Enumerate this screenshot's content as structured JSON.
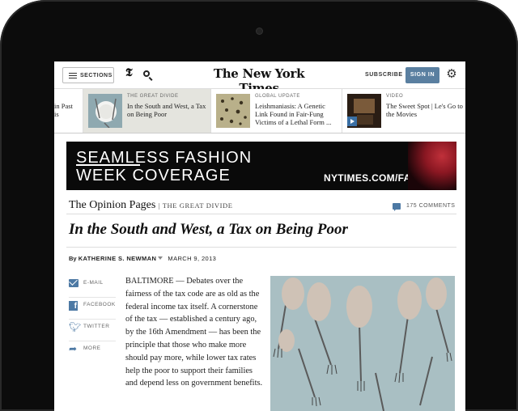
{
  "header": {
    "sections_label": "SECTIONS",
    "t_logo": "𝕿",
    "masthead": "The New York Times",
    "subscribe_label": "SUBSCRIBE",
    "signin_label": "SIGN IN"
  },
  "strip": {
    "items": [
      {
        "kicker": "",
        "headline": "in Past is"
      },
      {
        "kicker": "THE GREAT DIVIDE",
        "headline": "In the South and West, a Tax on Being Poor"
      },
      {
        "kicker": "GLOBAL UPDATE",
        "headline": "Leishmaniasis: A Genetic Link Found in Fair-Fung Victims of a Lethal Form ..."
      },
      {
        "kicker": "VIDEO",
        "headline": "The Sweet Spot | Le's Go to the Movies"
      }
    ]
  },
  "ad": {
    "line1": "SEAMLESS FASHION",
    "line2": "WEEK COVERAGE",
    "url": "NYTIMES.COM/FASHION"
  },
  "article": {
    "section": "The Opinion Pages",
    "series": "THE GREAT DIVIDE",
    "comments": "175 COMMENTS",
    "headline": "In the South and West, a Tax on Being Poor",
    "byline_by": "By",
    "author": "KATHERINE S. NEWMAN",
    "date": "MARCH 9, 2013",
    "body": "BALTIMORE — Debates over the fairness of the tax code are as old as the federal income tax itself. A cornerstone of the tax — established a century ago, by the 16th Amendment — has been the principle that those who make more should pay more, while lower tax rates help the poor to support their families and depend less on government benefits."
  },
  "share": {
    "email": "E-MAIL",
    "facebook": "FACEBOOK",
    "twitter": "TWITTER",
    "more": "MORE"
  },
  "colors": {
    "accent": "#4d79a4",
    "signin_bg": "#5a7fa0"
  }
}
